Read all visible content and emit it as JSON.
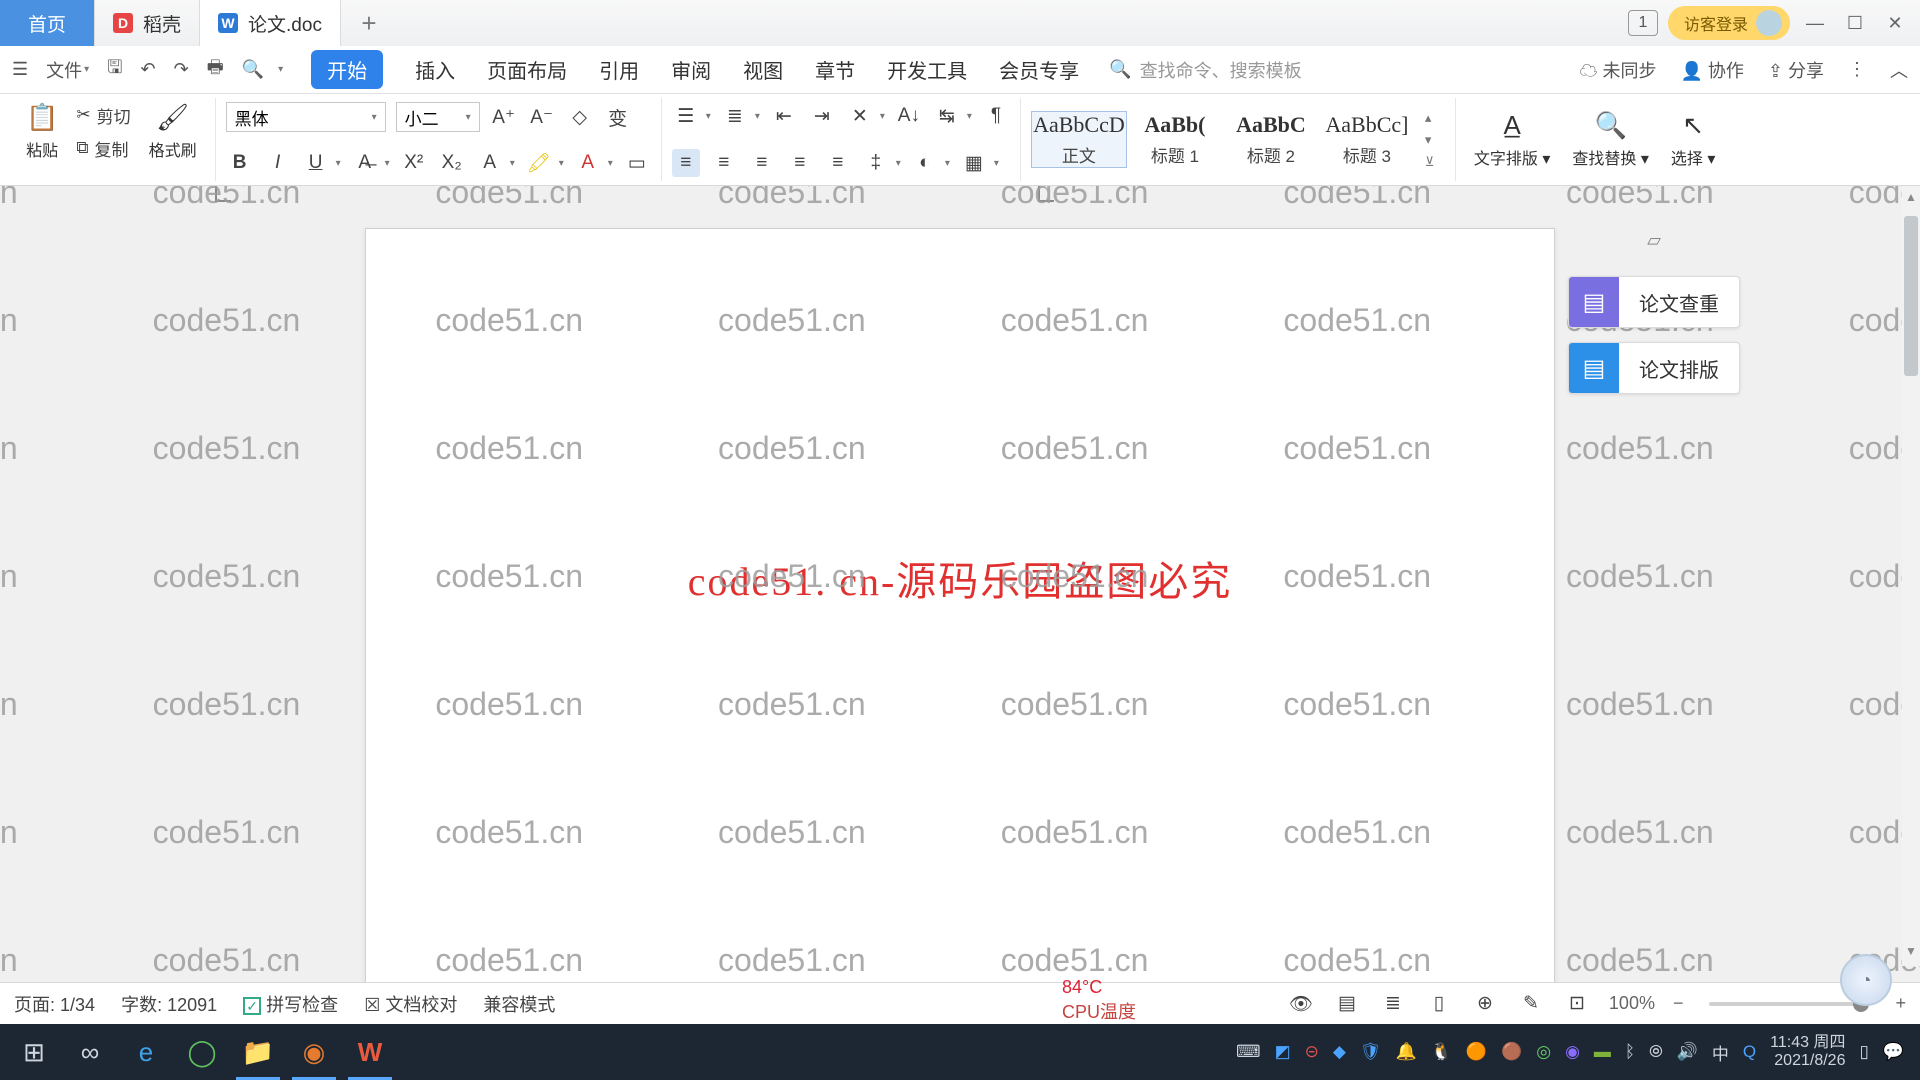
{
  "watermark": "code51.cn",
  "tabs": {
    "home": "首页",
    "docao": "稻壳",
    "doc": "论文.doc"
  },
  "title_right": {
    "one": "1",
    "guest": "访客登录"
  },
  "qa": {
    "file": "文件",
    "cut_label": "剪切",
    "copy_label": "复制"
  },
  "menus": [
    "开始",
    "插入",
    "页面布局",
    "引用",
    "审阅",
    "视图",
    "章节",
    "开发工具",
    "会员专享"
  ],
  "search_placeholder": "查找命令、搜索模板",
  "menu_right": {
    "unsync": "未同步",
    "collab": "协作",
    "share": "分享"
  },
  "ribbon": {
    "paste": "粘贴",
    "cut": "剪切",
    "copy": "复制",
    "format_painter": "格式刷",
    "font_name": "黑体",
    "font_size": "小二",
    "styles": [
      {
        "prev": "AaBbCcD",
        "lbl": "正文",
        "sel": true,
        "bold": false
      },
      {
        "prev": "AaBb(",
        "lbl": "标题 1",
        "sel": false,
        "bold": true
      },
      {
        "prev": "AaBbC",
        "lbl": "标题 2",
        "sel": false,
        "bold": true
      },
      {
        "prev": "AaBbCc]",
        "lbl": "标题 3",
        "sel": false,
        "bold": false
      }
    ],
    "text_layout": "文字排版",
    "find_replace": "查找替换",
    "select": "选择"
  },
  "side": {
    "check": "论文查重",
    "layout": "论文排版"
  },
  "document_text": "code51. cn-源码乐园盗图必究",
  "status": {
    "page_label": "页面:",
    "page": "1/34",
    "words_label": "字数:",
    "words": "12091",
    "spell": "拼写检查",
    "proof": "文档校对",
    "compat": "兼容模式",
    "zoom": "100%"
  },
  "cpu": {
    "temp": "84°C",
    "label": "CPU温度"
  },
  "clock": {
    "time": "11:43",
    "day": "周四",
    "date": "2021/8/26"
  }
}
